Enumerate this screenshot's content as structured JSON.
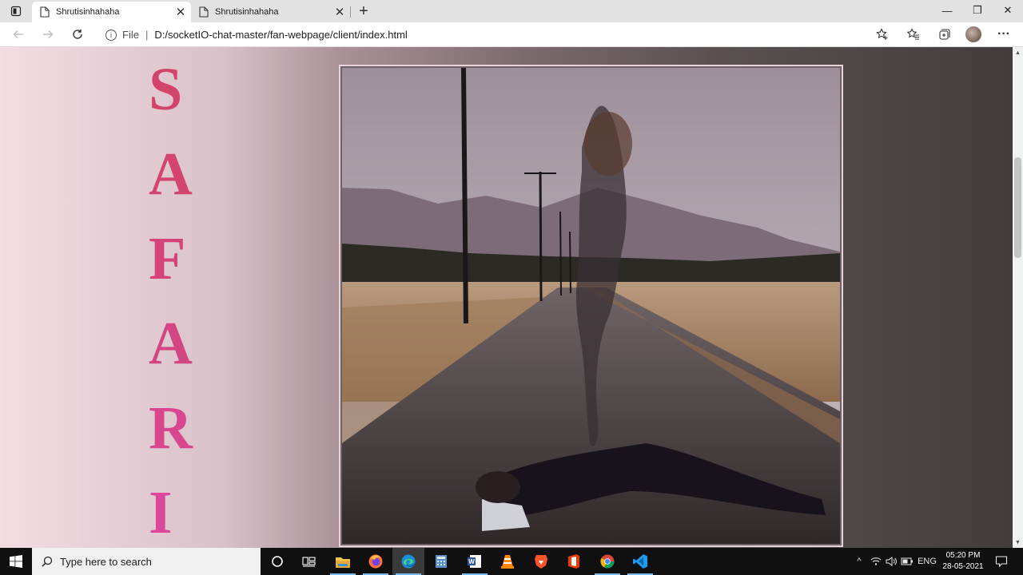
{
  "browser": {
    "tabs": [
      {
        "title": "Shrutisinhahaha",
        "close": "✕",
        "active": true
      },
      {
        "title": "Shrutisinhahaha",
        "close": "✕",
        "active": false
      }
    ],
    "new_tab": "+",
    "window_controls": {
      "minimize": "—",
      "maximize": "❐",
      "close": "✕"
    },
    "toolbar": {
      "back_icon": "back-arrow-icon",
      "forward_icon": "forward-arrow-icon",
      "refresh_icon": "refresh-icon",
      "info_glyph": "i",
      "scheme_label": "File",
      "separator": "|",
      "url": "D:/socketIO-chat-master/fan-webpage/client/index.html",
      "more_label": "···"
    }
  },
  "page": {
    "title_letters": [
      "S",
      "A",
      "F",
      "A",
      "R",
      "I"
    ],
    "title_colors": [
      "#d2446a",
      "#d44470",
      "#d44479",
      "#d44584",
      "#d8468f",
      "#dc479a"
    ],
    "photo_icon": "surreal-road-photo"
  },
  "scrollbar": {
    "up": "▲",
    "down": "▼"
  },
  "taskbar": {
    "search_placeholder": "Type here to search",
    "apps": [
      "cortana-icon",
      "task-view-icon",
      "file-explorer-icon",
      "firefox-icon",
      "edge-icon",
      "calculator-icon",
      "word-icon",
      "vlc-icon",
      "brave-icon",
      "office-icon",
      "chrome-icon",
      "vscode-icon"
    ],
    "language": "ENG",
    "time": "05:20 PM",
    "date": "28-05-2021",
    "tray_expand": "^"
  },
  "colors": {
    "accent_edge": "#0078d4",
    "title_pink": "#d8468f"
  }
}
